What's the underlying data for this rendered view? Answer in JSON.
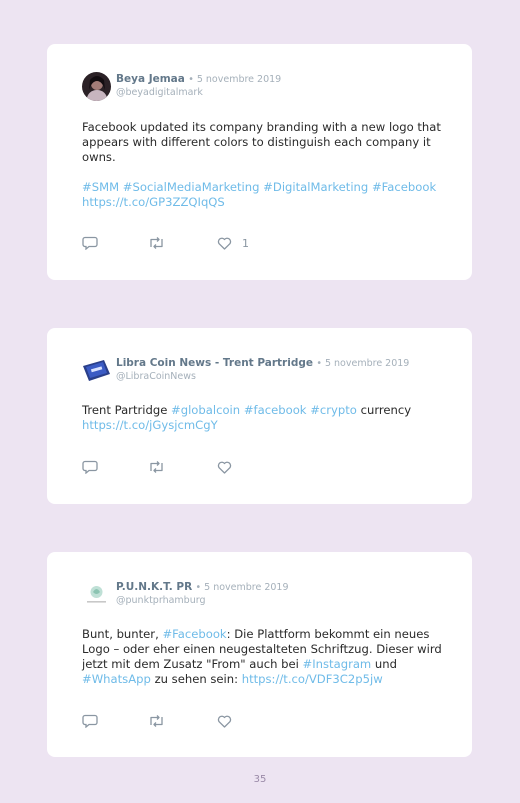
{
  "tweets": [
    {
      "author": "Beya Jemaa",
      "date": "• 5 novembre 2019",
      "handle": "@beyadigitalmark",
      "text_p1": "Facebook updated its company branding with a new logo that appears with different colors to distinguish each company it owns.",
      "tags": [
        "#SMM",
        "#SocialMediaMarketing",
        "#DigitalMarketing",
        "#Facebook"
      ],
      "url": "https://t.co/GP3ZZQIqQS",
      "like_count": "1",
      "icons": [
        "reply-icon",
        "retweet-icon",
        "heart-icon"
      ]
    },
    {
      "author": "Libra Coin News - Trent Partridge",
      "date": "• 5 novembre 2019",
      "handle": "@LibraCoinNews",
      "text_start": "Trent Partridge",
      "tags": [
        "#globalcoin",
        "#facebook",
        "#crypto"
      ],
      "text_end": "currency",
      "url": "https://t.co/jGysjcmCgY",
      "icons": [
        "reply-icon",
        "retweet-icon",
        "heart-icon"
      ]
    },
    {
      "author": "P.U.N.K.T. PR",
      "date": "• 5 novembre 2019",
      "handle": "@punktprhamburg",
      "text_a": "Bunt, bunter,",
      "tag_a": "#Facebook",
      "text_b": ": Die Plattform bekommt ein neues Logo – oder eher einen neugestalteten Schriftzug. Dieser wird jetzt mit dem Zusatz \"From\" auch bei",
      "tag_b": "#Instagram",
      "text_c": "und",
      "tag_c": "#WhatsApp",
      "text_d": "zu sehen sein:",
      "url": "https://t.co/VDF3C2p5jw",
      "icons": [
        "reply-icon",
        "retweet-icon",
        "heart-icon"
      ]
    }
  ],
  "page_number": "35",
  "colors": {
    "background": "#ede4f2",
    "card": "#ffffff",
    "link": "#6fbbe8",
    "name": "#63788a"
  }
}
